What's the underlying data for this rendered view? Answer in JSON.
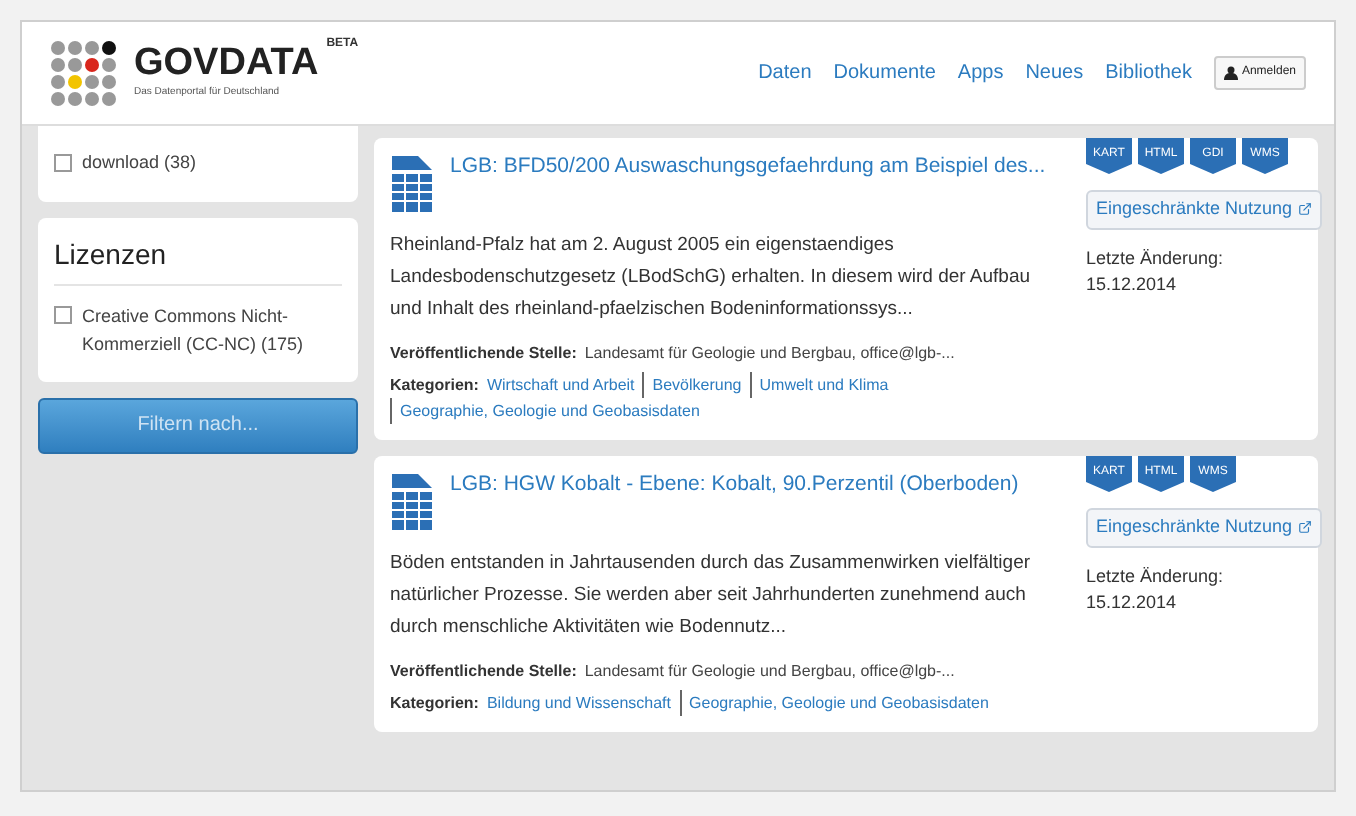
{
  "header": {
    "logo": "GOVDATA",
    "badge": "BETA",
    "tagline": "Das Datenportal für Deutschland",
    "nav": [
      {
        "label": "Daten"
      },
      {
        "label": "Dokumente"
      },
      {
        "label": "Apps"
      },
      {
        "label": "Neues"
      },
      {
        "label": "Bibliothek"
      }
    ],
    "login": "Anmelden"
  },
  "sidebar": {
    "formats": [
      {
        "label": "download (38)",
        "checked": false
      }
    ],
    "licenses": {
      "title": "Lizenzen",
      "items": [
        {
          "label": "Creative Commons Nicht-Kommerziell (CC-NC) (175)",
          "checked": false
        }
      ]
    },
    "filter_button": "Filtern nach..."
  },
  "results": [
    {
      "title": "LGB: BFD50/200 Auswaschungsgefaehrdung am Beispiel des...",
      "description": "Rheinland-Pfalz hat am 2. August 2005 ein eigenstaendiges Landesbodenschutzgesetz (LBodSchG) erhalten. In diesem wird der Aufbau und Inhalt des rheinland-pfaelzischen Bodeninformationssys...",
      "publisher_label": "Veröffentlichende Stelle:",
      "publisher": "Landesamt für Geologie und Bergbau, office@lgb-...",
      "categories_label": "Kategorien:",
      "categories": [
        "Wirtschaft und Arbeit",
        "Bevölkerung",
        "Umwelt und Klima",
        "Geographie, Geologie und Geobasisdaten"
      ],
      "formats": [
        "KART",
        "HTML",
        "GDI",
        "WMS"
      ],
      "license": "Eingeschränkte Nutzung",
      "modified_label": "Letzte Änderung:",
      "modified": "15.12.2014"
    },
    {
      "title": "LGB: HGW Kobalt - Ebene: Kobalt, 90.Perzentil (Oberboden)",
      "description": "Böden entstanden in Jahrtausenden durch das Zusammenwirken vielfältiger natürlicher Prozesse. Sie werden aber seit Jahrhunderten zunehmend auch durch menschliche Aktivitäten wie Bodennutz...",
      "publisher_label": "Veröffentlichende Stelle:",
      "publisher": "Landesamt für Geologie und Bergbau, office@lgb-...",
      "categories_label": "Kategorien:",
      "categories": [
        "Bildung und Wissenschaft",
        "Geographie, Geologie und Geobasisdaten"
      ],
      "formats": [
        "KART",
        "HTML",
        "WMS"
      ],
      "license": "Eingeschränkte Nutzung",
      "modified_label": "Letzte Änderung:",
      "modified": "15.12.2014"
    }
  ]
}
